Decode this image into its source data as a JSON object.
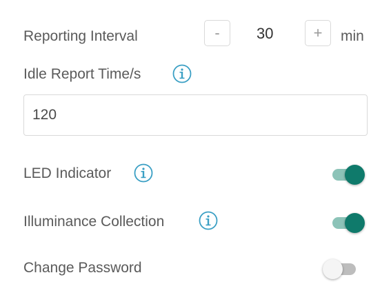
{
  "reporting_interval": {
    "label": "Reporting Interval",
    "decrement_label": "-",
    "value": "30",
    "increment_label": "+",
    "unit": "min"
  },
  "idle_report": {
    "label": "Idle Report Time/s",
    "value": "120",
    "info_icon": "info-circle-icon"
  },
  "led_indicator": {
    "label": "LED Indicator",
    "info_icon": "info-circle-icon",
    "enabled": true
  },
  "illuminance_collection": {
    "label": "Illuminance Collection",
    "info_icon": "info-circle-icon",
    "enabled": true
  },
  "change_password": {
    "label": "Change Password",
    "enabled": false
  },
  "colors": {
    "accent": "#0f7a6b",
    "accent_track": "#8cc3b8",
    "info_icon": "#3a9fc4",
    "off_track": "#bdbdbd",
    "off_thumb": "#f5f5f5"
  }
}
